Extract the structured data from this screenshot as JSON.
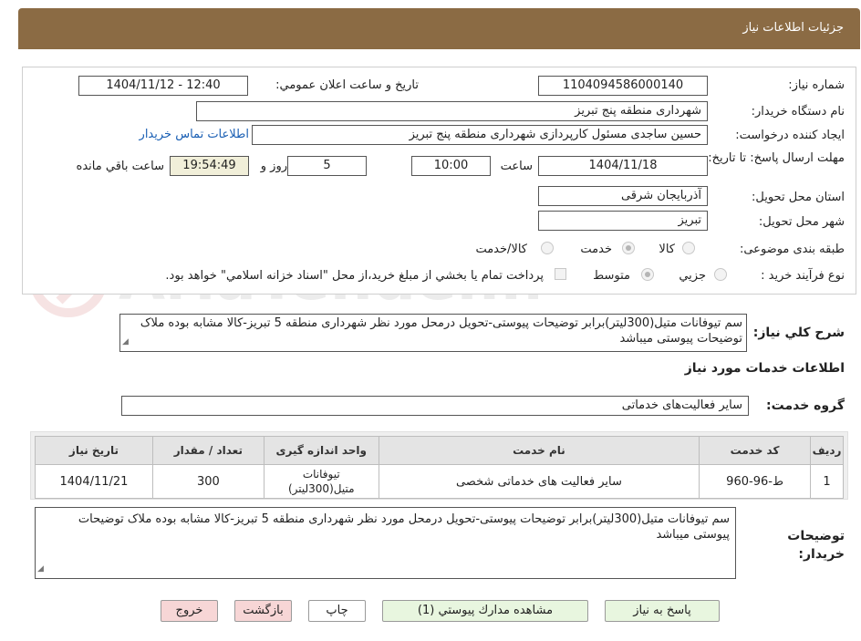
{
  "header": {
    "title": "جزئيات اطلاعات نياز"
  },
  "form": {
    "need_number_label": "شماره نياز:",
    "need_number": "1104094586000140",
    "announce_label": "تاريخ و ساعت اعلان عمومي:",
    "announce_value": "1404/11/12 - 12:40",
    "buyer_label": "نام دستگاه خريدار:",
    "buyer_value": "شهرداری منطقه پنج تبریز",
    "creator_label": "ايجاد كننده درخواست:",
    "creator_value": "حسین ساجدی مسئول کارپردازی شهرداری منطقه پنج تبریز",
    "contact_link": "اطلاعات تماس خريدار",
    "deadline_label": "مهلت ارسال پاسخ: تا تاريخ:",
    "deadline_date": "1404/11/18",
    "time_label": "ساعت",
    "deadline_time": "10:00",
    "days_value": "5",
    "days_label": "روز و",
    "remaining_time": "19:54:49",
    "remaining_label": "ساعت باقي مانده",
    "province_label": "استان محل تحويل:",
    "province_value": "آذربایجان شرقی",
    "city_label": "شهر محل تحويل:",
    "city_value": "تبریز",
    "category_label": "طبقه بندی موضوعی:",
    "category_options": [
      "کالا",
      "خدمت",
      "کالا/خدمت"
    ],
    "category_selected": "خدمت",
    "process_label": "نوع فرآيند خريد :",
    "process_options": [
      "جزیي",
      "متوسط"
    ],
    "process_selected": "متوسط",
    "payment_note": "پرداخت تمام يا بخشي از مبلغ خريد،از محل \"اسناد خزانه اسلامي\" خواهد بود."
  },
  "summary": {
    "label": "شرح كلي نياز:",
    "text": "سم تیوفانات متیل(300لیتر)برابر توضیحات پیوستی-تحویل درمحل مورد نظر شهرداری منطقه 5 تبریز-کالا مشابه بوده ملاک توضیحات پیوستی میباشد"
  },
  "services": {
    "section_title": "اطلاعات خدمات مورد نياز",
    "group_label": "گروه خدمت:",
    "group_value": "سایر فعالیت‌های خدماتی",
    "columns": [
      "رديف",
      "كد خدمت",
      "نام خدمت",
      "واحد اندازه گيری",
      "تعداد / مقدار",
      "تاريخ نياز"
    ],
    "rows": [
      [
        "1",
        "ط-96-960",
        "سایر فعالیت های خدماتی شخصی",
        "تیوفانات متیل(300لیتر)",
        "300",
        "1404/11/21"
      ]
    ]
  },
  "buyer_notes": {
    "label": "توضيحات خريدار:",
    "text": "سم تیوفانات متیل(300لیتر)برابر توضیحات پیوستی-تحویل درمحل مورد نظر شهرداری منطقه 5 تبریز-کالا مشابه بوده ملاک توضیحات پیوستی میباشد"
  },
  "buttons": {
    "respond": "پاسخ به نياز",
    "attachments": "مشاهده مدارك پيوستي (1)",
    "print": "چاپ",
    "back": "بازگشت",
    "exit": "خروج"
  },
  "watermark": {
    "text": "AriaTender.neT"
  },
  "colors": {
    "header_bg": "#8b6b44",
    "green_button": "#e8f6df",
    "pink_button": "#f7d6d6",
    "remaining_bg": "#f1efd9",
    "link": "#1a5fb4"
  }
}
